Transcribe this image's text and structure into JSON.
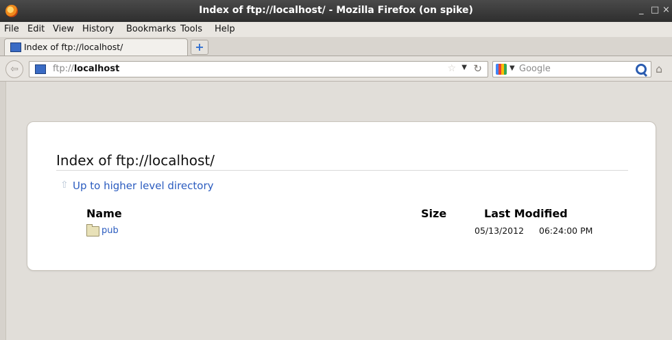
{
  "window": {
    "title": "Index of ftp://localhost/ - Mozilla Firefox (on spike)",
    "minimize": "_",
    "maximize": "□",
    "close": "×"
  },
  "menu": [
    {
      "label": "File"
    },
    {
      "label": "Edit"
    },
    {
      "label": "View"
    },
    {
      "label": "History"
    },
    {
      "label": "Bookmarks"
    },
    {
      "label": "Tools"
    },
    {
      "label": "Help"
    }
  ],
  "tabs": [
    {
      "label": "Index of ftp://localhost/"
    }
  ],
  "newtab_label": "+",
  "navbar": {
    "url_scheme": "ftp://",
    "url_host": "localhost",
    "search_placeholder": "Google"
  },
  "page": {
    "title": "Index of ftp://localhost/",
    "up_link": "Up to higher level directory",
    "columns": {
      "name": "Name",
      "size": "Size",
      "last_modified": "Last Modified"
    },
    "rows": [
      {
        "name": "pub",
        "size": "",
        "date": "05/13/2012",
        "time": "06:24:00 PM"
      }
    ]
  },
  "icons": {
    "app": "firefox-icon",
    "favicon": "monitor-icon",
    "back": "back-arrow-icon",
    "bookmark": "star-icon",
    "reload": "reload-icon",
    "search_engine": "google-icon",
    "search": "magnifier-icon",
    "home": "home-icon",
    "folder": "folder-icon",
    "up": "up-arrow-icon"
  },
  "colors": {
    "link": "#2a5bbf",
    "titlebar": "#2e2e2e",
    "content_bg": "#e1ded9"
  }
}
